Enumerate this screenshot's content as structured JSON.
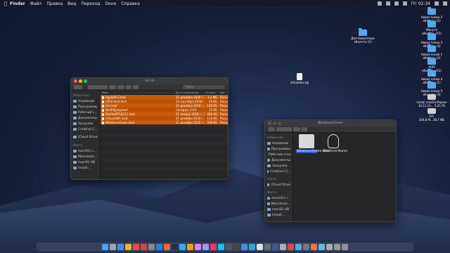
{
  "menubar": {
    "items": [
      "Finder",
      "Файл",
      "Правка",
      "Вид",
      "Переход",
      "Окно",
      "Справка"
    ],
    "clock": "Пт 02:34"
  },
  "desktop": {
    "icons": [
      {
        "label": "Новая папка 2",
        "sub": "объекты (1)",
        "type": "folder"
      },
      {
        "label": "Минута",
        "sub": "объекты (15)",
        "type": "folder"
      },
      {
        "label": "Для Хакинтоша",
        "sub": "объекты (1)",
        "type": "folder"
      },
      {
        "label": "Новая папка 3",
        "sub": "объекты (3)",
        "type": "folder"
      },
      {
        "label": "Новая папка 1",
        "sub": "объекты (3)",
        "type": "folder"
      },
      {
        "label": "ACPI",
        "sub": "объекты (12)",
        "type": "folder"
      },
      {
        "label": "Новая папка 4",
        "sub": "объекты (1)",
        "type": "folder"
      },
      {
        "label": "Новая папка 5",
        "sub": "объекты (3)",
        "type": "folder"
      },
      {
        "label": "Install macOS Mojave",
        "sub": "10,11,15... 5,01 ГБ",
        "type": "disk"
      },
      {
        "label": "EFI",
        "sub": "204,8 М...38,7 МБ",
        "type": "disk"
      },
      {
        "label": "virtualdev.zip",
        "sub": "",
        "type": "file"
      }
    ]
  },
  "finder1": {
    "title": "10.14",
    "search_placeholder": "Поиск",
    "sidebar": {
      "favorites_header": "Избранное",
      "favorites": [
        "Недавние",
        "Программы",
        "Рабочий с...",
        "Документы",
        "Загрузки",
        "Creative C..."
      ],
      "icloud": "iCloud Drive",
      "places_header": "Места",
      "places": [
        "macOS's i...",
        "Macintosh...",
        "macOS HD",
        "Install..."
      ]
    },
    "columns": [
      "Имя",
      "Дата изменения",
      "Размер",
      "Тип"
    ],
    "rows": [
      {
        "name": "AppleALC.kext",
        "date": "21 декабря 2018 г., 16:06",
        "size": "1,2 МБ",
        "kind": "Расши..."
      },
      {
        "name": "CPUFriend.kext",
        "date": "12 сентября 2018 г., 16:06",
        "size": "44 КБ",
        "kind": "Расши..."
      },
      {
        "name": "Lilu.kext",
        "date": "21 декабря 2018 г., 16:09",
        "size": "148 КБ",
        "kind": "Расши..."
      },
      {
        "name": "NoVPAJpeg.kext",
        "date": "Сегодня, 2:54",
        "size": "31 КБ",
        "kind": "Расши..."
      },
      {
        "name": "RealtekRTL8111.kext",
        "date": "21 января 2018 г., 21:30",
        "size": "468 КБ",
        "kind": "Расши..."
      },
      {
        "name": "VirtualSMC.kext",
        "date": "21 декабря 2018 г., 18:08",
        "size": "110 КБ",
        "kind": "Расши..."
      },
      {
        "name": "WhateverGreen.kext",
        "date": "21 декабря 2018 г., 16:06",
        "size": "508 КБ",
        "kind": "Расши..."
      }
    ]
  },
  "finder2": {
    "title": "WhateverGreen",
    "sidebar": {
      "favorites_header": "Избранное",
      "favorites": [
        "Недавние",
        "Программы",
        "Рабочий стол",
        "Документы",
        "Загрузки",
        "Creative Cl..."
      ],
      "icloud_header": "iCloud",
      "icloud": "iCloud Drive",
      "places_header": "Места",
      "places": [
        "macOS's i...",
        "Macintosh...",
        "macOS HD",
        "Install..."
      ]
    },
    "items": [
      {
        "label": "WhateverGreen.kext",
        "selected": true
      },
      {
        "label": "WhateverName",
        "selected": false
      }
    ]
  },
  "colors": {
    "selection": "#c85a0a",
    "folder": "#5aa7e8"
  }
}
